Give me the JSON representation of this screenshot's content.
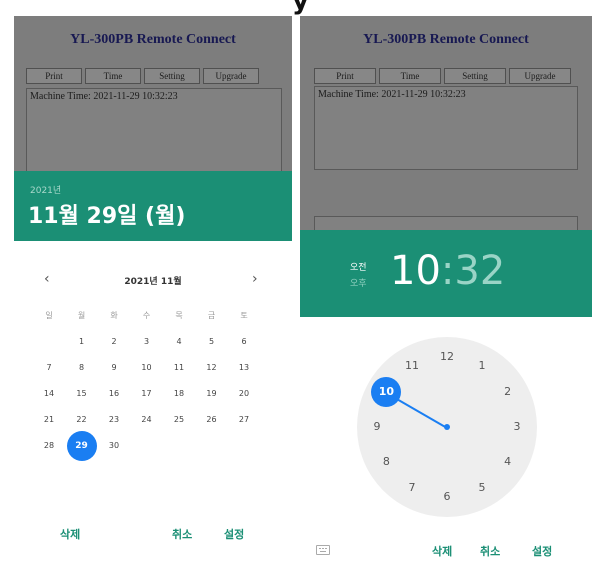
{
  "app": {
    "title": "YL-300PB Remote Connect",
    "buttons": [
      "Print",
      "Time",
      "Setting",
      "Upgrade"
    ],
    "machine_time": "Machine Time: 2021-11-29 10:32:23"
  },
  "date_picker": {
    "year": "2021년",
    "selected_date": "11월 29일 (월)",
    "month_label": "2021년 11월",
    "prev_icon": "‹",
    "next_icon": "›",
    "weekdays": [
      "일",
      "월",
      "화",
      "수",
      "목",
      "금",
      "토"
    ],
    "weeks": [
      [
        "",
        "1",
        "2",
        "3",
        "4",
        "5",
        "6"
      ],
      [
        "7",
        "8",
        "9",
        "10",
        "11",
        "12",
        "13"
      ],
      [
        "14",
        "15",
        "16",
        "17",
        "18",
        "19",
        "20"
      ],
      [
        "21",
        "22",
        "23",
        "24",
        "25",
        "26",
        "27"
      ],
      [
        "28",
        "29",
        "30",
        "",
        "",
        "",
        ""
      ]
    ],
    "selected_day": "29",
    "buttons": {
      "delete": "삭제",
      "cancel": "취소",
      "set": "설정"
    }
  },
  "time_picker": {
    "am": "오전",
    "pm": "오후",
    "hour": "10",
    "separator": ":",
    "minute": "32",
    "clock_numbers": [
      "12",
      "1",
      "2",
      "3",
      "4",
      "5",
      "6",
      "7",
      "8",
      "9",
      "10",
      "11"
    ],
    "selected_hour": "10",
    "buttons": {
      "delete": "삭제",
      "cancel": "취소",
      "set": "설정"
    },
    "keyboard_icon": "keyboard-icon"
  },
  "colors": {
    "accent": "#1b8f75",
    "selection": "#1a7ef2"
  }
}
